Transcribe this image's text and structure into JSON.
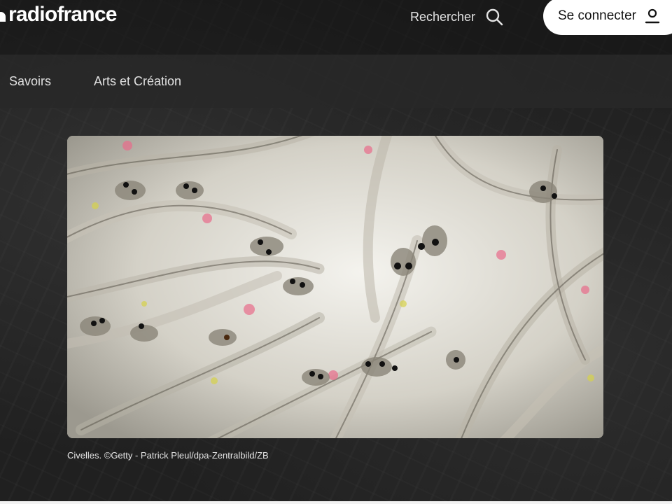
{
  "header": {
    "logo_text": "radiofrance",
    "search_label": "Rechercher",
    "search_icon": "magnifier",
    "connect_label": "Se connecter",
    "connect_icon": "user"
  },
  "nav": {
    "items": [
      {
        "label": "Savoirs"
      },
      {
        "label": "Arts et Création"
      }
    ]
  },
  "article": {
    "image_subject": "Civelles",
    "caption": "Civelles. ©Getty - Patrick Pleul/dpa-Zentralbild/ZB"
  },
  "colors": {
    "background": "#202020",
    "header_bg": "#151515",
    "nav_bg": "#2a2a2a",
    "text": "#ffffff",
    "button_bg": "#ffffff"
  }
}
